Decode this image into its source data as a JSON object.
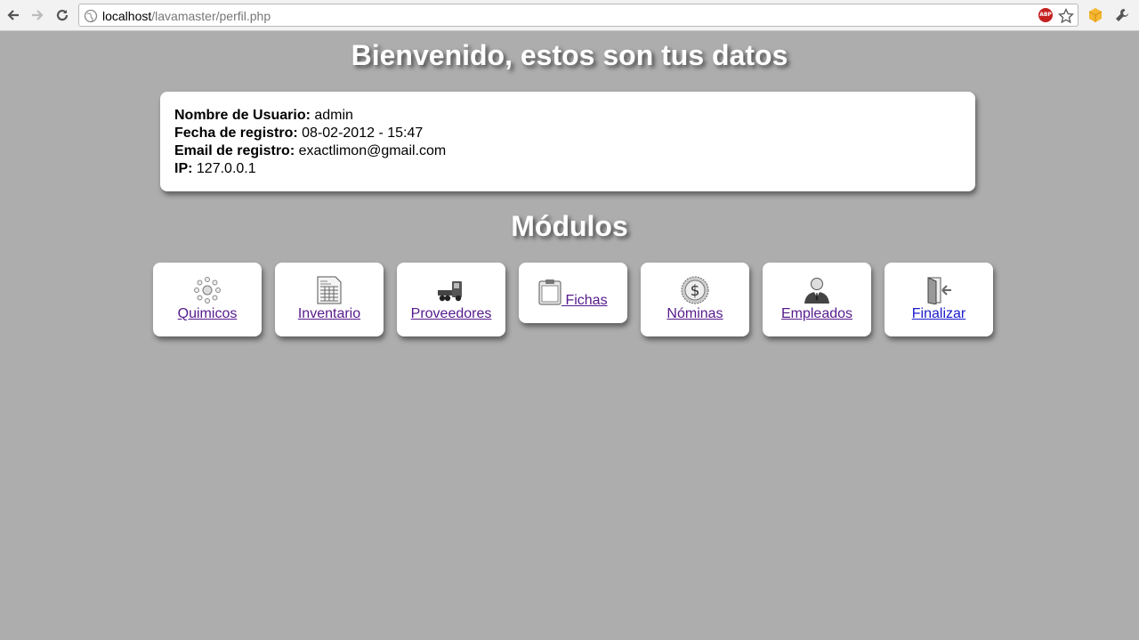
{
  "browser": {
    "url_host": "localhost",
    "url_path": "/lavamaster/perfil.php",
    "abp_label": "ABP"
  },
  "page": {
    "welcome_title": "Bienvenido, estos son tus datos",
    "modules_title": "Módulos"
  },
  "user_info": {
    "username_label": "Nombre de Usuario:",
    "username_value": "admin",
    "date_label": "Fecha de registro:",
    "date_value": "08-02-2012 - 15:47",
    "email_label": "Email de registro:",
    "email_value": "exactlimon@gmail.com",
    "ip_label": "IP:",
    "ip_value": "127.0.0.1"
  },
  "modules": [
    {
      "label": "Quimicos",
      "icon": "molecule-icon"
    },
    {
      "label": "Inventario",
      "icon": "spreadsheet-icon"
    },
    {
      "label": "Proveedores",
      "icon": "truck-icon"
    },
    {
      "label": "Fichas",
      "icon": "clipboard-icon"
    },
    {
      "label": "Nóminas",
      "icon": "dollar-coin-icon"
    },
    {
      "label": "Empleados",
      "icon": "person-icon"
    },
    {
      "label": "Finalizar",
      "icon": "exit-door-icon"
    }
  ],
  "colors": {
    "background": "#adadad",
    "visited_link": "#551a8b",
    "link": "#1a1acc"
  }
}
